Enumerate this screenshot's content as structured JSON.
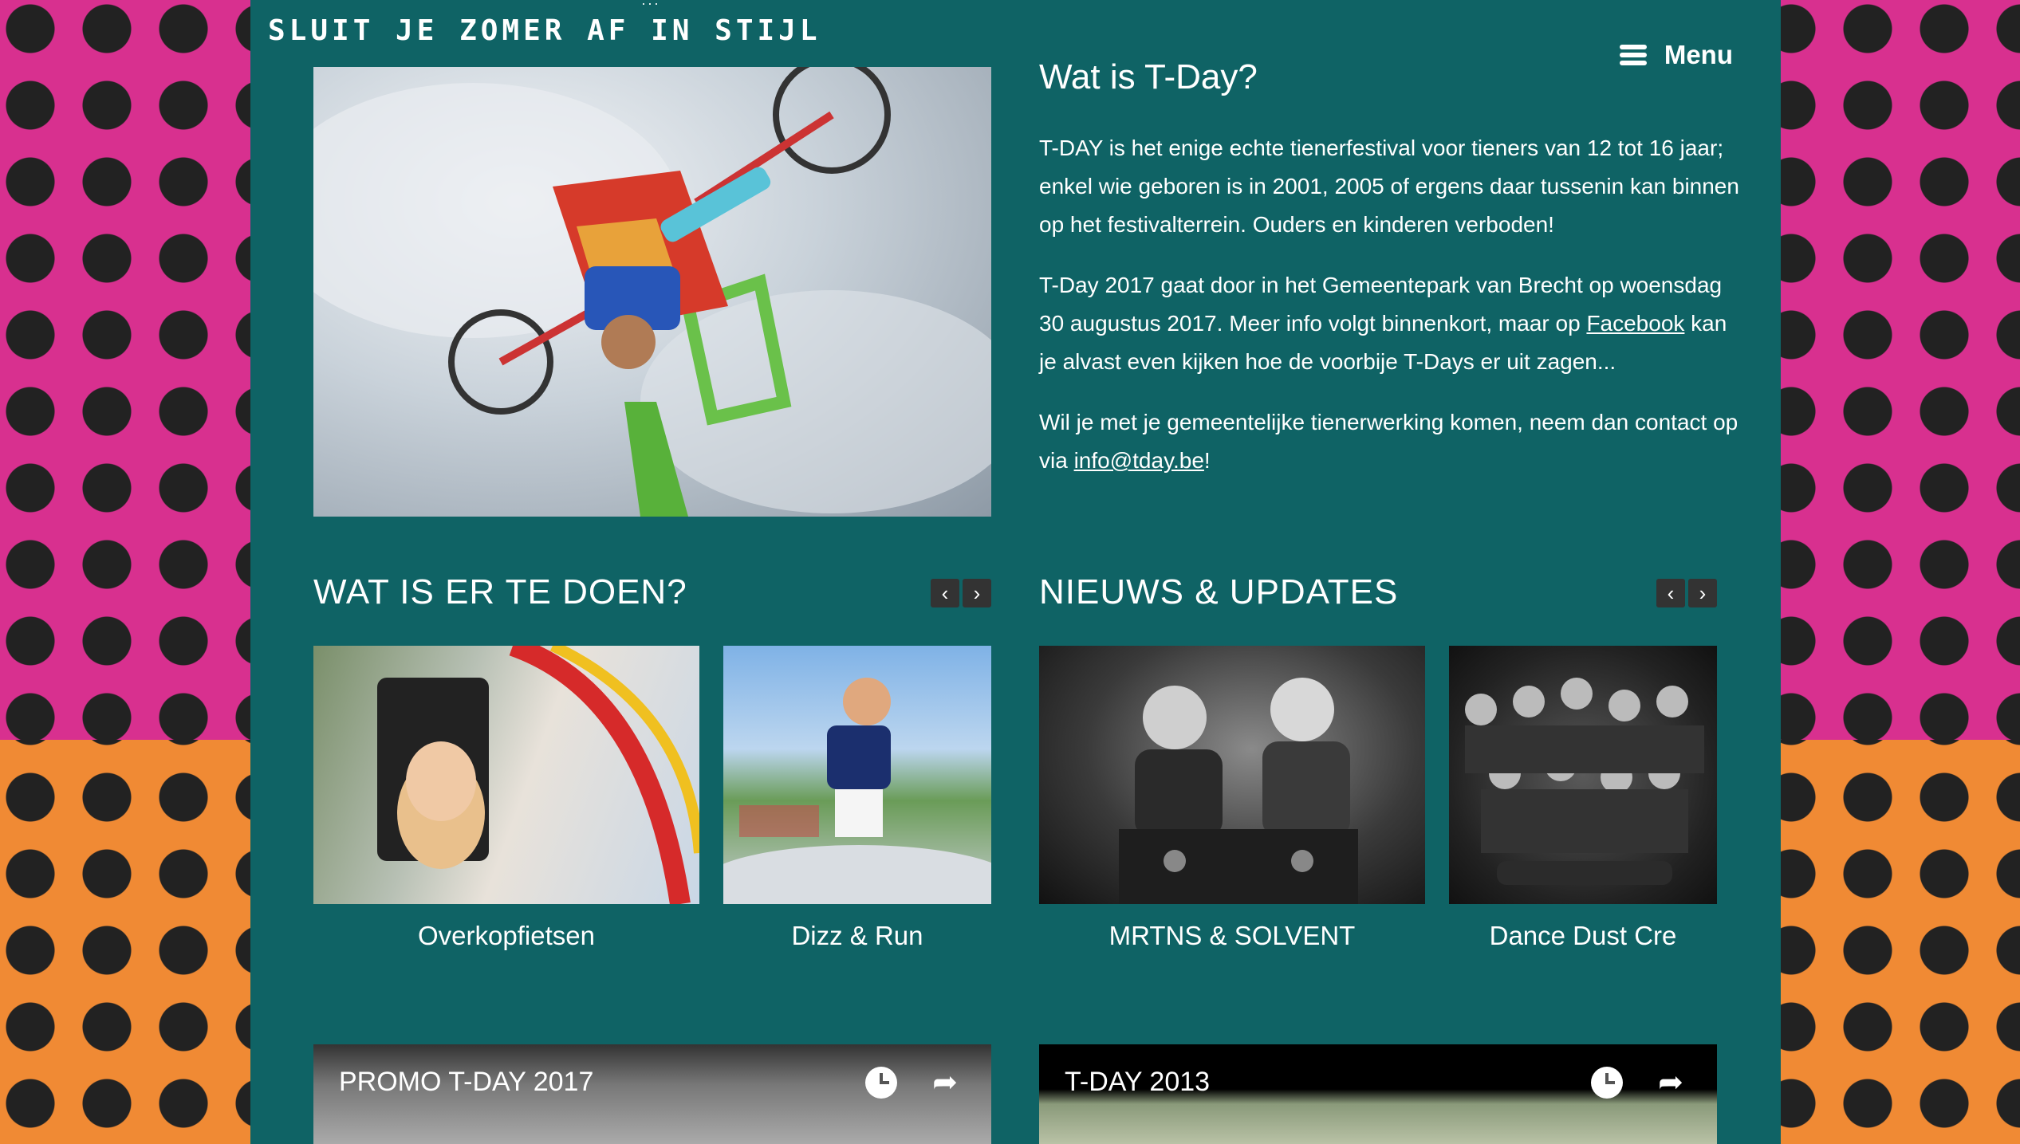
{
  "header": {
    "tagline": "SLUIT JE ZOMER AF IN STIJL",
    "menu_label": "Menu"
  },
  "intro": {
    "title": "Wat is T-Day?",
    "p1": "T-DAY is het enige echte tienerfestival voor tieners van 12 tot 16 jaar; enkel wie geboren is in 2001, 2005 of ergens daar tussenin kan binnen op het festivalterrein. Ouders en kinderen verboden!",
    "p2_before": "T-Day 2017 gaat door in het Gemeentepark van Brecht op woensdag 30 augustus 2017. Meer info volgt binnenkort, maar op ",
    "p2_link": "Facebook",
    "p2_after": " kan je alvast even kijken hoe de voorbije T-Days er uit zagen...",
    "p3_before": "Wil je met je gemeentelijke tienerwerking komen, neem dan contact op via ",
    "p3_link": "info@tday.be",
    "p3_after": "!"
  },
  "activities": {
    "title": "WAT IS ER TE DOEN?",
    "prev": "‹",
    "next": "›",
    "items": [
      {
        "label": "Overkopfietsen"
      },
      {
        "label": "Dizz & Run"
      }
    ]
  },
  "news": {
    "title": "NIEUWS & UPDATES",
    "prev": "‹",
    "next": "›",
    "items": [
      {
        "label": "MRTNS & SOLVENT"
      },
      {
        "label": "Dance Dust Cre"
      }
    ]
  },
  "videos": [
    {
      "title": "PROMO T-DAY 2017"
    },
    {
      "title": "T-DAY 2013"
    }
  ],
  "icons": {
    "menu": "hamburger-icon",
    "prev": "chevron-left-icon",
    "next": "chevron-right-icon",
    "watch_later": "clock-icon",
    "share": "share-icon"
  },
  "colors": {
    "panel": "#0f6365",
    "bg_top": "#d8308f",
    "bg_bottom": "#f08a34",
    "dots": "#222222"
  }
}
